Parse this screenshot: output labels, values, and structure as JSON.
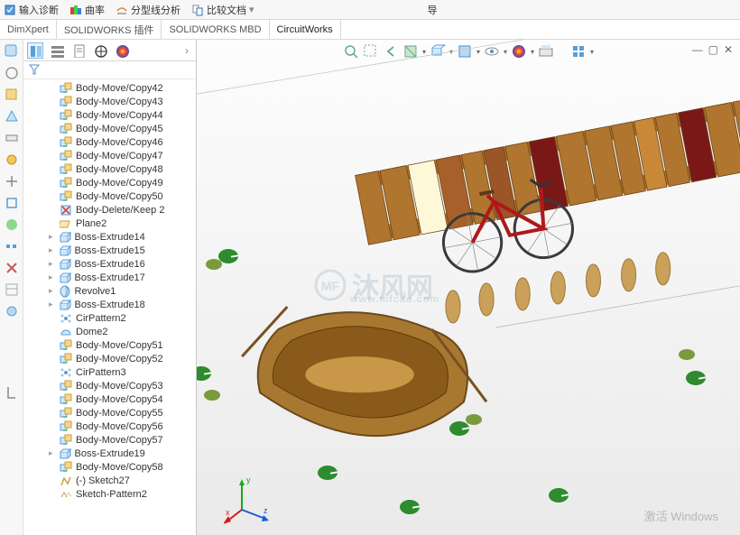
{
  "top_menu": {
    "diag": "输入诊断",
    "curv": "曲率",
    "analysis": "分型线分析",
    "compare": "比较文档",
    "guide": "导"
  },
  "tabs": [
    "DimXpert",
    "SOLIDWORKS 插件",
    "SOLIDWORKS MBD",
    "CircuitWorks"
  ],
  "tree": [
    {
      "t": "bodymove",
      "l": "Body-Move/Copy42"
    },
    {
      "t": "bodymove",
      "l": "Body-Move/Copy43"
    },
    {
      "t": "bodymove",
      "l": "Body-Move/Copy44"
    },
    {
      "t": "bodymove",
      "l": "Body-Move/Copy45"
    },
    {
      "t": "bodymove",
      "l": "Body-Move/Copy46"
    },
    {
      "t": "bodymove",
      "l": "Body-Move/Copy47"
    },
    {
      "t": "bodymove",
      "l": "Body-Move/Copy48"
    },
    {
      "t": "bodymove",
      "l": "Body-Move/Copy49"
    },
    {
      "t": "bodymove",
      "l": "Body-Move/Copy50"
    },
    {
      "t": "bodydel",
      "l": "Body-Delete/Keep 2"
    },
    {
      "t": "plane",
      "l": "Plane2"
    },
    {
      "t": "extrude",
      "l": "Boss-Extrude14",
      "e": true
    },
    {
      "t": "extrude",
      "l": "Boss-Extrude15",
      "e": true
    },
    {
      "t": "extrude",
      "l": "Boss-Extrude16",
      "e": true
    },
    {
      "t": "extrude",
      "l": "Boss-Extrude17",
      "e": true
    },
    {
      "t": "revolve",
      "l": "Revolve1",
      "e": true
    },
    {
      "t": "extrude",
      "l": "Boss-Extrude18",
      "e": true
    },
    {
      "t": "cirpat",
      "l": "CirPattern2"
    },
    {
      "t": "dome",
      "l": "Dome2"
    },
    {
      "t": "bodymove",
      "l": "Body-Move/Copy51"
    },
    {
      "t": "bodymove",
      "l": "Body-Move/Copy52"
    },
    {
      "t": "cirpat",
      "l": "CirPattern3"
    },
    {
      "t": "bodymove",
      "l": "Body-Move/Copy53"
    },
    {
      "t": "bodymove",
      "l": "Body-Move/Copy54"
    },
    {
      "t": "bodymove",
      "l": "Body-Move/Copy55"
    },
    {
      "t": "bodymove",
      "l": "Body-Move/Copy56"
    },
    {
      "t": "bodymove",
      "l": "Body-Move/Copy57"
    },
    {
      "t": "extrude",
      "l": "Boss-Extrude19",
      "e": true
    },
    {
      "t": "bodymove",
      "l": "Body-Move/Copy58"
    },
    {
      "t": "sketch",
      "l": "(-) Sketch27"
    },
    {
      "t": "sketchpat",
      "l": "Sketch-Pattern2"
    }
  ],
  "watermark": {
    "main": "沐风网",
    "sub": "www.mfcad.com"
  },
  "activate": "激活 Windows",
  "triad": {
    "x": "x",
    "y": "y",
    "z": "z"
  }
}
